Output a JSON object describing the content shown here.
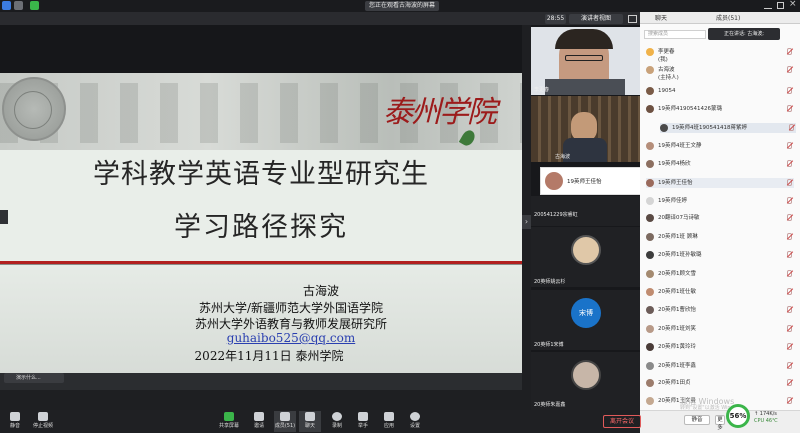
{
  "topbar": {
    "share_notice": "您正在观看古海波的屏幕"
  },
  "sharebar": {
    "time": "28:55",
    "view_mode": "演讲者视图"
  },
  "slide": {
    "calligraphy": "泰州学院",
    "title_line1": "学科教学英语专业型研究生",
    "title_line2": "学习路径探究",
    "author": "古海波",
    "affiliation1": "苏州大学/新疆师范大学外国语学院",
    "affiliation2": "苏州大学外语教育与教师发展研究所",
    "email": "guhaibo525@qq.com",
    "date_place": "2022年11月11日 泰州学院",
    "caption": "演示什么..."
  },
  "gallery": {
    "tiles": [
      {
        "label": "李更春"
      },
      {
        "label": "古海波"
      },
      {
        "label": "19英师王佳怡"
      },
      {
        "label": "200541229宗睿虹"
      },
      {
        "label": "20英师姚云杉"
      },
      {
        "label": "20英师1宋博",
        "avatar_text": "宋博"
      },
      {
        "label": "20英师朱嘉鑫"
      }
    ]
  },
  "panel": {
    "tab_chat": "聊天",
    "tab_members": "成员(51)",
    "speaking": "正在讲话: 古海波;",
    "search_placeholder": "搜索成员",
    "rows": [
      {
        "name": "李更春"
      },
      {
        "name": "(我)"
      },
      {
        "name": "古海波"
      },
      {
        "name": "(主持人)"
      },
      {
        "name": "19054"
      },
      {
        "name": "19英师4190541426蒙璐"
      },
      {
        "name": "19英师4班190541418蒋紫婷"
      },
      {
        "name": "19英师4班王文静"
      },
      {
        "name": "19英师4杨欣"
      },
      {
        "name": "19英师王佳怡"
      },
      {
        "name": "19英师佳婷"
      },
      {
        "name": "20翻译07马诗敏"
      },
      {
        "name": "20英师1班 顾琳"
      },
      {
        "name": "20英师1班孙敏璐"
      },
      {
        "name": "20英师1顾文雪"
      },
      {
        "name": "20英师1班仕敏"
      },
      {
        "name": "20英师1曹欣怡"
      },
      {
        "name": "20英师1班刘笑"
      },
      {
        "name": "20英师1黄玲玲"
      },
      {
        "name": "20英师1班李鑫"
      },
      {
        "name": "20英师1田贞"
      },
      {
        "name": "20英师1王文曼"
      },
      {
        "name": "20英师1夏天"
      },
      {
        "name": "20英师1班孙梓明"
      }
    ],
    "mute_all": "静音",
    "more": "更多",
    "watermark": "激活 Windows",
    "watermark_sub": "转到\"设置\"以激活 Windows。",
    "gauge": "56%",
    "net": "↑ 174K/s",
    "cpu": "CPU 46℃"
  },
  "toolbar": {
    "items": [
      {
        "label": "静音"
      },
      {
        "label": "停止视频"
      },
      {
        "label": "共享屏幕"
      },
      {
        "label": "邀请"
      },
      {
        "label": "成员(51)"
      },
      {
        "label": "聊天"
      },
      {
        "label": "录制"
      },
      {
        "label": "举手"
      },
      {
        "label": "应用"
      },
      {
        "label": "设置"
      }
    ],
    "leave": "离开会议"
  }
}
